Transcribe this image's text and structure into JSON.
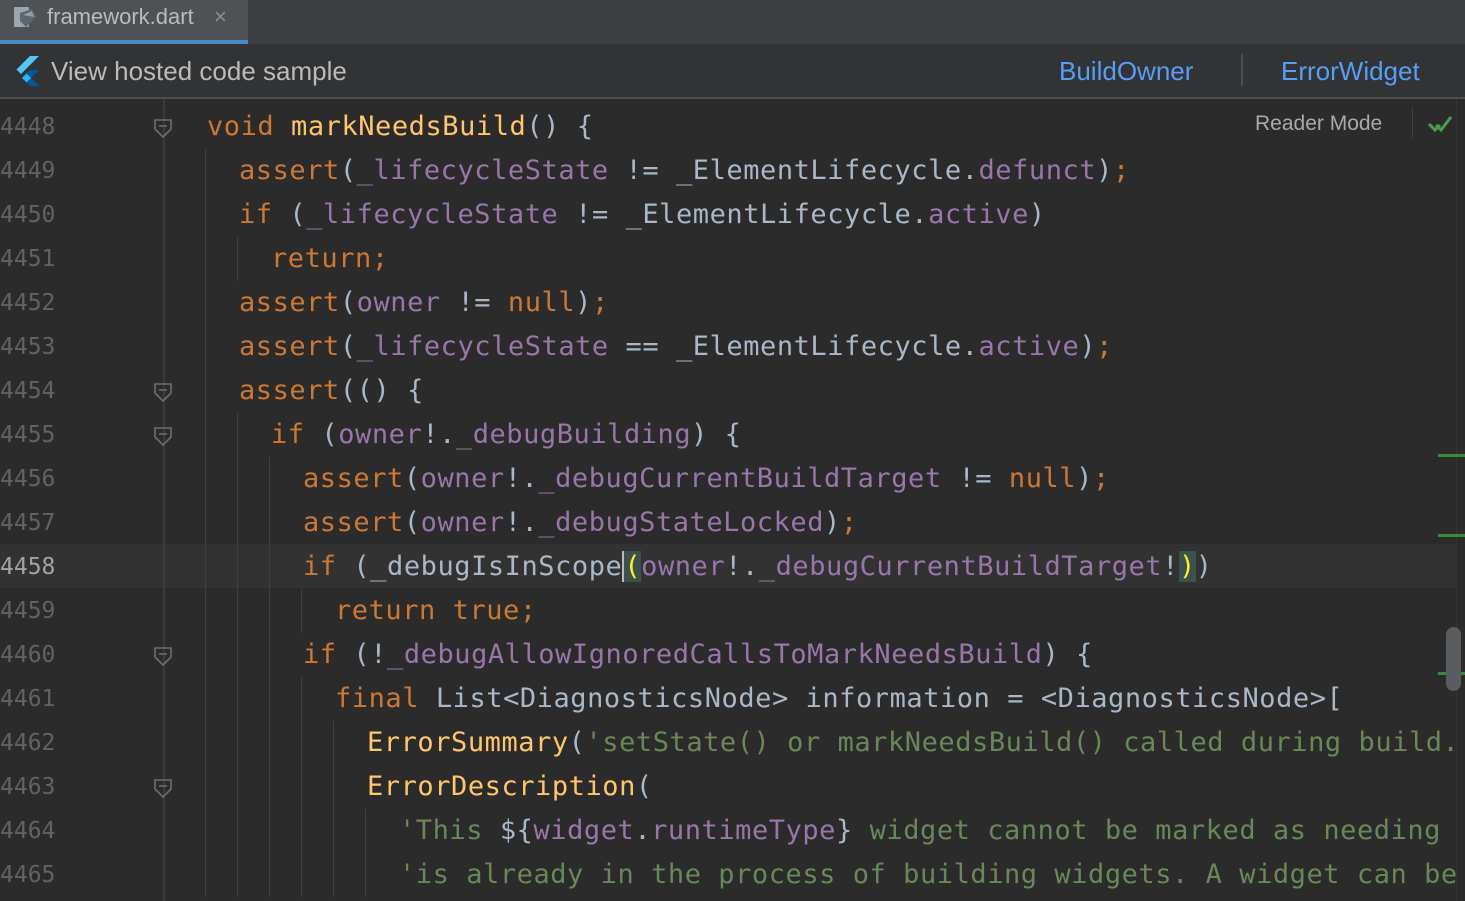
{
  "tab": {
    "filename": "framework.dart",
    "close_glyph": "×",
    "icon": "dart-file-icon"
  },
  "banner": {
    "icon": "flutter-logo-icon",
    "link_label": "View hosted code sample",
    "nav_left": "BuildOwner",
    "nav_right": "ErrorWidget"
  },
  "editor": {
    "reader_mode": "Reader Mode",
    "inspection_icon": "check-icon",
    "current_line": "4458",
    "lines": [
      {
        "n": "4448",
        "fold": true
      },
      {
        "n": "4449",
        "fold": false
      },
      {
        "n": "4450",
        "fold": false
      },
      {
        "n": "4451",
        "fold": false
      },
      {
        "n": "4452",
        "fold": false
      },
      {
        "n": "4453",
        "fold": false
      },
      {
        "n": "4454",
        "fold": true
      },
      {
        "n": "4455",
        "fold": true
      },
      {
        "n": "4456",
        "fold": false
      },
      {
        "n": "4457",
        "fold": false
      },
      {
        "n": "4458",
        "fold": false
      },
      {
        "n": "4459",
        "fold": false
      },
      {
        "n": "4460",
        "fold": true
      },
      {
        "n": "4461",
        "fold": false
      },
      {
        "n": "4462",
        "fold": false
      },
      {
        "n": "4463",
        "fold": true
      },
      {
        "n": "4464",
        "fold": false
      },
      {
        "n": "4465",
        "fold": false
      }
    ],
    "code": [
      [
        [
          "kw",
          "void "
        ],
        [
          "fn",
          "markNeedsBuild"
        ],
        [
          "",
          "() {"
        ]
      ],
      [
        [
          "kw",
          "assert"
        ],
        [
          "",
          "("
        ],
        [
          "prop",
          "_lifecycleState"
        ],
        [
          "",
          " != "
        ],
        [
          "ty",
          "_ElementLifecycle"
        ],
        [
          "",
          "."
        ],
        [
          "prop",
          "defunct"
        ],
        [
          "",
          ")"
        ],
        [
          "kw",
          ";"
        ]
      ],
      [
        [
          "kw",
          "if "
        ],
        [
          "",
          "("
        ],
        [
          "prop",
          "_lifecycleState"
        ],
        [
          "",
          " != "
        ],
        [
          "ty",
          "_ElementLifecycle"
        ],
        [
          "",
          "."
        ],
        [
          "prop",
          "active"
        ],
        [
          "",
          ")"
        ]
      ],
      [
        [
          "kw",
          "return;"
        ]
      ],
      [
        [
          "kw",
          "assert"
        ],
        [
          "",
          "("
        ],
        [
          "prop",
          "owner"
        ],
        [
          "",
          " != "
        ],
        [
          "kw",
          "null"
        ],
        [
          "",
          ")"
        ],
        [
          "kw",
          ";"
        ]
      ],
      [
        [
          "kw",
          "assert"
        ],
        [
          "",
          "("
        ],
        [
          "prop",
          "_lifecycleState"
        ],
        [
          "",
          " == "
        ],
        [
          "ty",
          "_ElementLifecycle"
        ],
        [
          "",
          "."
        ],
        [
          "prop",
          "active"
        ],
        [
          "",
          ")"
        ],
        [
          "kw",
          ";"
        ]
      ],
      [
        [
          "kw",
          "assert"
        ],
        [
          "",
          "(() {"
        ]
      ],
      [
        [
          "kw",
          "if "
        ],
        [
          "",
          "("
        ],
        [
          "prop",
          "owner"
        ],
        [
          "",
          "!."
        ],
        [
          "prop",
          "_debugBuilding"
        ],
        [
          "",
          ") {"
        ]
      ],
      [
        [
          "kw",
          "assert"
        ],
        [
          "",
          "("
        ],
        [
          "prop",
          "owner"
        ],
        [
          "",
          "!."
        ],
        [
          "prop",
          "_debugCurrentBuildTarget"
        ],
        [
          "",
          " != "
        ],
        [
          "kw",
          "null"
        ],
        [
          "",
          ")"
        ],
        [
          "kw",
          ";"
        ]
      ],
      [
        [
          "kw",
          "assert"
        ],
        [
          "",
          "("
        ],
        [
          "prop",
          "owner"
        ],
        [
          "",
          "!."
        ],
        [
          "prop",
          "_debugStateLocked"
        ],
        [
          "",
          ")"
        ],
        [
          "kw",
          ";"
        ]
      ],
      [
        [
          "kw",
          "if "
        ],
        [
          "",
          "("
        ],
        [
          "",
          "_debugIsInScope"
        ],
        [
          "cursor",
          ""
        ],
        [
          "match",
          "("
        ],
        [
          "prop",
          "owner"
        ],
        [
          "",
          "!."
        ],
        [
          "prop",
          "_debugCurrentBuildTarget"
        ],
        [
          "",
          "!"
        ],
        [
          "match",
          ")"
        ],
        [
          "",
          ")"
        ]
      ],
      [
        [
          "kw",
          "return true;"
        ]
      ],
      [
        [
          "kw",
          "if "
        ],
        [
          "",
          "(!"
        ],
        [
          "prop",
          "_debugAllowIgnoredCallsToMarkNeedsBuild"
        ],
        [
          "",
          ") {"
        ]
      ],
      [
        [
          "kw",
          "final "
        ],
        [
          "",
          "List<DiagnosticsNode> information = <DiagnosticsNode>["
        ]
      ],
      [
        [
          "fn",
          "ErrorSummary"
        ],
        [
          "",
          "("
        ],
        [
          "str",
          "'setState() or markNeedsBuild() called during build.'"
        ],
        [
          "",
          "),"
        ]
      ],
      [
        [
          "fn",
          "ErrorDescription"
        ],
        [
          "",
          "("
        ]
      ],
      [
        [
          "str",
          "'This "
        ],
        [
          "",
          "${"
        ],
        [
          "prop",
          "widget"
        ],
        [
          "",
          "."
        ],
        [
          "prop",
          "runtimeType"
        ],
        [
          "",
          "}"
        ],
        [
          "str",
          " widget cannot be marked as needing to b"
        ]
      ],
      [
        [
          "str",
          "'is already in the process of building widgets. A widget can be mar"
        ]
      ]
    ]
  }
}
